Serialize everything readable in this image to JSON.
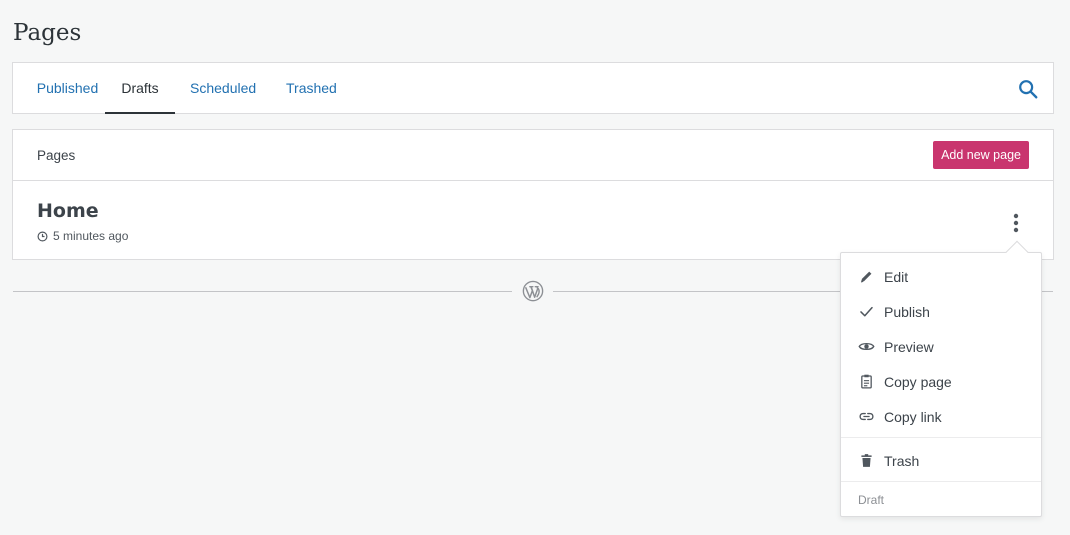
{
  "header": {
    "title": "Pages"
  },
  "tabs": [
    {
      "label": "Published",
      "active": false
    },
    {
      "label": "Drafts",
      "active": true
    },
    {
      "label": "Scheduled",
      "active": false
    },
    {
      "label": "Trashed",
      "active": false
    }
  ],
  "list": {
    "header_label": "Pages",
    "add_button_label": "Add new page",
    "items": [
      {
        "title": "Home",
        "modified": "5 minutes ago"
      }
    ]
  },
  "menu": {
    "items": [
      {
        "label": "Edit",
        "icon": "pencil-icon"
      },
      {
        "label": "Publish",
        "icon": "checkmark-icon"
      },
      {
        "label": "Preview",
        "icon": "eye-icon"
      },
      {
        "label": "Copy page",
        "icon": "clipboard-icon"
      },
      {
        "label": "Copy link",
        "icon": "link-icon"
      },
      {
        "label": "Trash",
        "icon": "trash-icon"
      }
    ],
    "status": "Draft"
  },
  "colors": {
    "accent": "#c9356e",
    "link": "#2271b1",
    "text": "#2c3338",
    "background": "#f6f7f7"
  }
}
